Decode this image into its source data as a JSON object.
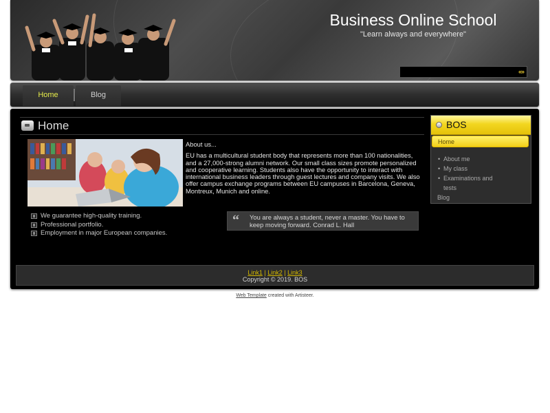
{
  "header": {
    "title": "Business Online School",
    "slogan": "\"Learn  always and everywhere\"",
    "search_placeholder": "",
    "search_button_glyph": "«»"
  },
  "nav": {
    "items": [
      {
        "label": "Home",
        "active": true
      },
      {
        "label": "Blog",
        "active": false
      }
    ]
  },
  "post": {
    "title": "Home",
    "about_label": "About us...",
    "body": "EU has a multicultural student body that represents more than 100 nationalities, and a 27,000-strong alumni network. Our small class sizes promote personalized and cooperative learning. Students also have the opportunity to interact with international business leaders through guest lectures and company visits. We also offer campus exchange programs between EU campuses in Barcelona, Geneva, Montreux, Munich and online.",
    "features": [
      "We guarantee high-quality training.",
      "Professional portfolio.",
      "Employment in major European companies."
    ],
    "quote": "You are always a student, never a master. You have to keep moving forward. Conrad L. Hall"
  },
  "sidebar": {
    "title": "BOS",
    "home_label": "Home",
    "sub_items": [
      "About me",
      "My class",
      "Examinations and",
      "tests"
    ],
    "blog_label": "Blog"
  },
  "footer": {
    "links": [
      "Link1",
      "Link2",
      "Link3"
    ],
    "separator": "|",
    "copyright": "Copyright © 2019. BOS"
  },
  "credit": {
    "link_text": "Web Template",
    "suffix": " created with Artisteer."
  },
  "colors": {
    "accent_yellow": "#f2d620",
    "nav_active": "#e6ec4a",
    "sheet_bg": "#000000",
    "footer_link": "#d4b800"
  },
  "icons": {
    "post_header": "page-icon",
    "feature_bullet": "checkbox-bullet-icon",
    "quote": "quote-mark-icon",
    "sidebar_header": "circle-bullet-icon"
  }
}
